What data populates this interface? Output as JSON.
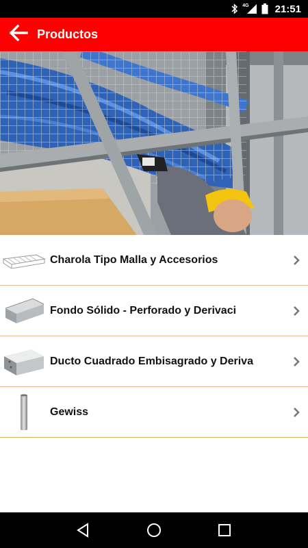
{
  "status_bar": {
    "time": "21:51",
    "network": "4G",
    "icons": [
      "bluetooth-icon",
      "signal-icon",
      "battery-icon"
    ]
  },
  "app_bar": {
    "title": "Productos",
    "back_icon": "arrow-left-icon",
    "color": "#ff0000"
  },
  "hero": {
    "description_icon": "cable-tray-photo"
  },
  "products": [
    {
      "label": "Charola Tipo Malla y Accesorios",
      "thumb_icon": "wire-mesh-tray-icon"
    },
    {
      "label": "Fondo Sólido - Perforado y Derivaci",
      "thumb_icon": "solid-tray-icon"
    },
    {
      "label": "Ducto Cuadrado Embisagrado y Deriva",
      "thumb_icon": "square-duct-icon"
    },
    {
      "label": "Gewiss",
      "thumb_icon": "conduit-tube-icon"
    }
  ],
  "nav_bar": {
    "back": "nav-back-icon",
    "home": "nav-home-icon",
    "recents": "nav-recents-icon"
  }
}
